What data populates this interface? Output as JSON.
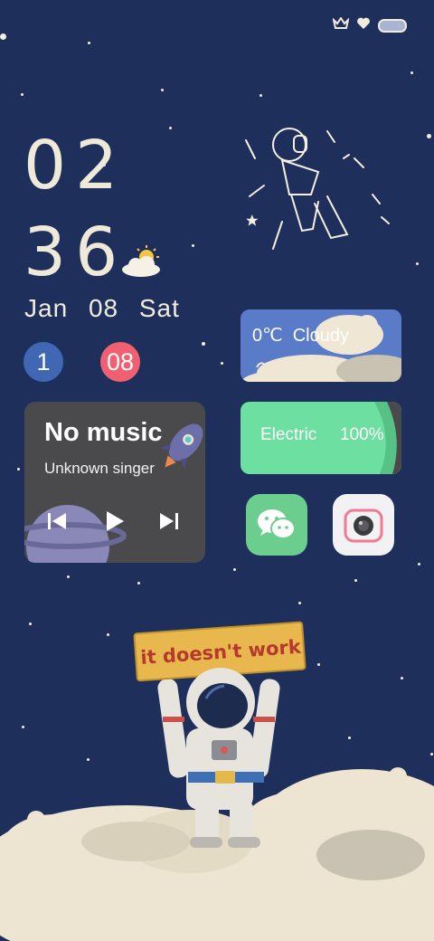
{
  "status_bar": {
    "icons": [
      "crown-icon",
      "heart-shield-icon",
      "battery-icon"
    ]
  },
  "clock": {
    "hour": "02",
    "minute": "36"
  },
  "date": {
    "month": "Jan",
    "day": "08",
    "weekday": "Sat"
  },
  "badges": {
    "left": "1",
    "right": "08"
  },
  "weather": {
    "temperature": "0℃",
    "condition": "Cloudy"
  },
  "music": {
    "title": "No music",
    "artist": "Unknown singer",
    "controls": [
      "previous-icon",
      "play-icon",
      "next-icon"
    ]
  },
  "battery_widget": {
    "label": "Electric",
    "value": "100%"
  },
  "apps": [
    {
      "name": "wechat",
      "icon": "wechat-icon"
    },
    {
      "name": "camera",
      "icon": "camera-icon"
    }
  ],
  "wallpaper": {
    "sign_text": "it doesn't work"
  },
  "colors": {
    "background": "#1f2f5c",
    "music_widget": "#4a4a4d",
    "weather_widget": "#5a7bc8",
    "electric_widget": "#6ddfa0",
    "badge_blue": "#3f67b4",
    "badge_red": "#f06070"
  }
}
